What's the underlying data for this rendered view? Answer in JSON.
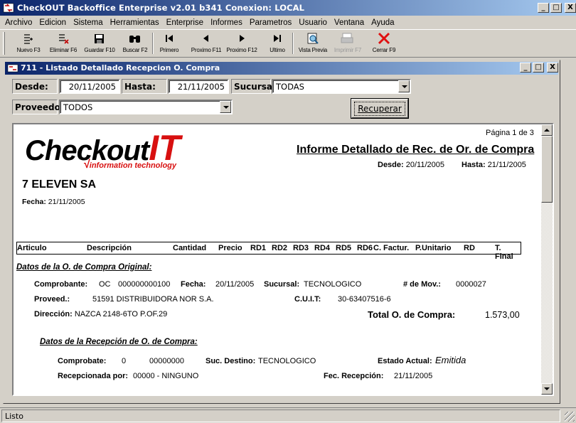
{
  "app": {
    "title": "CheckOUT Backoffice Enterprise v2.01 b341 Conexion: LOCAL",
    "minimize": "_",
    "maximize": "□",
    "close": "X"
  },
  "menu": [
    "Archivo",
    "Edicion",
    "Sistema",
    "Herramientas",
    "Enterprise",
    "Informes",
    "Parametros",
    "Usuario",
    "Ventana",
    "Ayuda"
  ],
  "toolbar": {
    "nuevo": "Nuevo F3",
    "eliminar": "Eliminar F6",
    "guardar": "Guardar F10",
    "buscar": "Buscar F2",
    "primero": "Primero",
    "proximo_f11": "Proximo F11",
    "proximo_f12": "Proximo F12",
    "ultimo": "Ultimo",
    "vista_previa": "Vista Previa",
    "imprimir": "Imprimir F7",
    "cerrar": "Cerrar F9"
  },
  "child_window": {
    "title": "711 - Listado Detallado Recepcion O. Compra"
  },
  "filters": {
    "desde_label": "Desde:",
    "desde_value": "20/11/2005",
    "hasta_label": "Hasta:",
    "hasta_value": "21/11/2005",
    "sucursal_label": "Sucursal:",
    "sucursal_value": "TODAS",
    "proveedor_label": "Proveedor:",
    "proveedor_value": "TODOS",
    "recuperar": "Recuperar"
  },
  "report": {
    "logo_main": "Checkout",
    "logo_it": "IT",
    "logo_sub": "information technology",
    "pagina": "Página 1 de 3",
    "title": "Informe Detallado de Rec. de Or. de Compra",
    "desde_label": "Desde:",
    "desde_value": "20/11/2005",
    "hasta_label": "Hasta:",
    "hasta_value": "21/11/2005",
    "company": "7 ELEVEN SA",
    "fecha_label": "Fecha:",
    "fecha_value": "21/11/2005",
    "columns": [
      "Articulo",
      "Descripción",
      "Cantidad",
      "Precio",
      "RD1",
      "RD2",
      "RD3",
      "RD4",
      "RD5",
      "RD6",
      "C. Factur.",
      "P.Unitario",
      "RD",
      "T. Final"
    ],
    "section1_title": "Datos de la O. de Compra Original:",
    "comprobante_label": "Comprobante:",
    "comprobante_type": "OC",
    "comprobante_num": "000000000100",
    "fecha2_label": "Fecha:",
    "fecha2_value": "20/11/2005",
    "sucursal_label": "Sucursal:",
    "sucursal_value": "TECNOLOGICO",
    "mov_label": "# de Mov.:",
    "mov_value": "0000027",
    "proveed_label": "Proveed.:",
    "proveed_value": "51591 DISTRIBUIDORA NOR S.A.",
    "cuit_label": "C.U.I.T:",
    "cuit_value": "30-63407516-6",
    "direccion_label": "Dirección:",
    "direccion_value": "NAZCA 2148-6TO P.OF.29",
    "total_label": "Total O. de Compra:",
    "total_value": "1.573,00",
    "section2_title": "Datos de la Recepción de O. de Compra:",
    "comprobate_label": "Comprobate:",
    "comprobate_a": "0",
    "comprobate_b": "00000000",
    "suc_destino_label": "Suc. Destino:",
    "suc_destino_value": "TECNOLOGICO",
    "estado_label": "Estado Actual:",
    "estado_value": "Emitida",
    "recepcionada_label": "Recepcionada por:",
    "recepcionada_value": "00000 - NINGUNO",
    "fec_recepcion_label": "Fec. Recepción:",
    "fec_recepcion_value": "21/11/2005"
  },
  "status": {
    "text": "Listo"
  }
}
